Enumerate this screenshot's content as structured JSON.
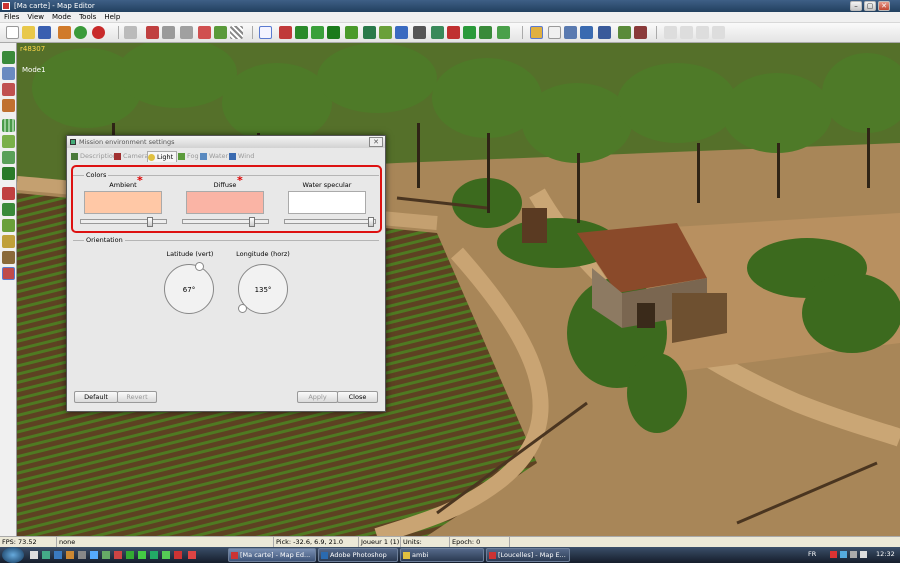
{
  "window": {
    "title": "[Ma carte] - Map Editor",
    "min": "–",
    "max": "▢",
    "close": "✕"
  },
  "menu": [
    "Files",
    "View",
    "Mode",
    "Tools",
    "Help"
  ],
  "viewport": {
    "coord_readout": "r48307",
    "mode_label": "Mode1"
  },
  "dialog": {
    "title": "Mission environment settings",
    "close": "✕",
    "tabs": [
      "Description",
      "Camera",
      "Light",
      "Fog",
      "Water",
      "Wind"
    ],
    "active_tab": "Light",
    "colors_group": "Colors",
    "ambient_label": "Ambient",
    "diffuse_label": "Diffuse",
    "water_specular_label": "Water specular",
    "ambient_color": "#ffc8a6",
    "diffuse_color": "#fab4a5",
    "water_specular_color": "#ffffff",
    "ambient_slider": 0.84,
    "diffuse_slider": 0.84,
    "water_specular_slider": 0.99,
    "modified_marker": "*",
    "orientation_group": "Orientation",
    "latitude_label": "Latitude (vert)",
    "longitude_label": "Longitude (horz)",
    "latitude_value": "67°",
    "longitude_value": "135°",
    "buttons": {
      "default": "Default",
      "revert": "Revert",
      "apply": "Apply",
      "close": "Close"
    }
  },
  "status": {
    "fps": "FPS: 73.52",
    "selection": "none",
    "pick": "Pick: -32.6, 6.9, 21.0",
    "player": "Joueur 1 (1)",
    "units": "Units:",
    "epoch": "Epoch: 0"
  },
  "taskbar": {
    "tasks": [
      "[Ma carte] - Map Ed...",
      "Adobe Photoshop",
      "ambi",
      "[Loucelles] - Map E..."
    ],
    "lang": "FR",
    "clock": "12:32"
  }
}
